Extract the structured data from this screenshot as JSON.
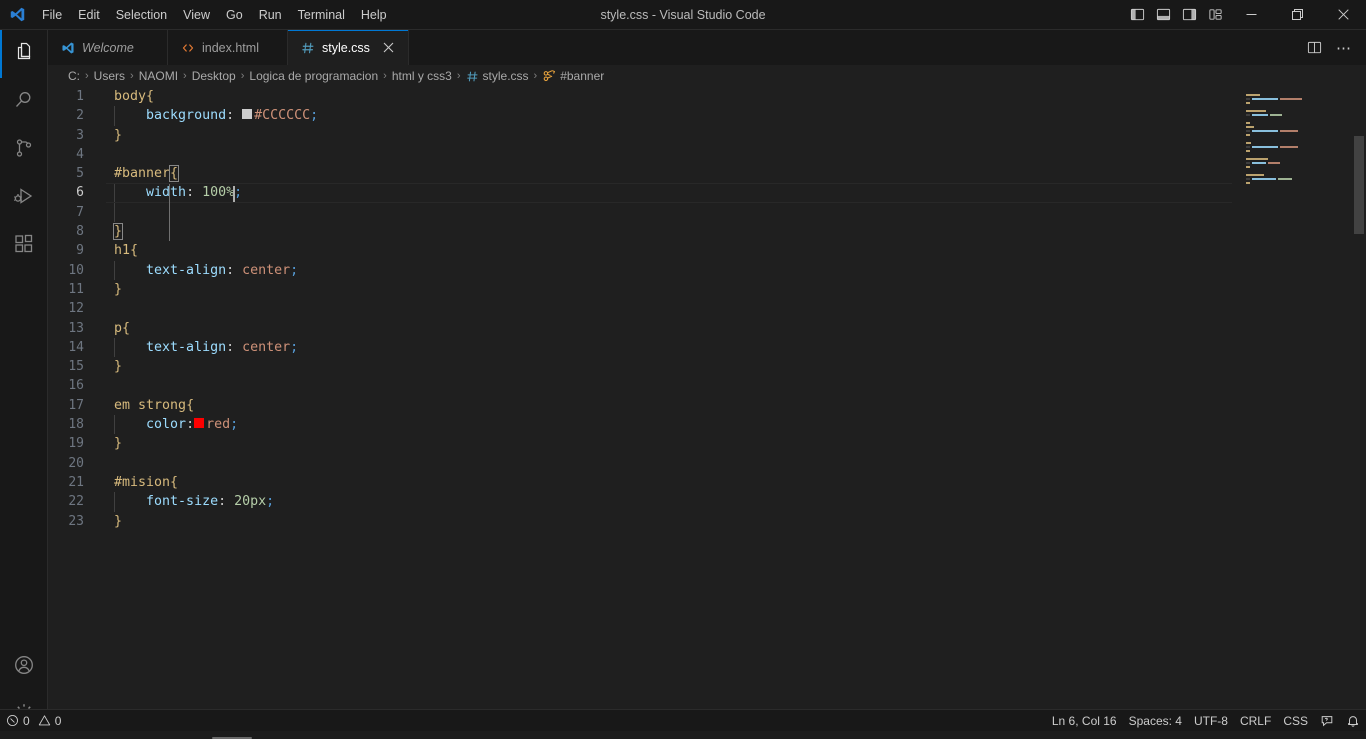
{
  "window": {
    "title": "style.css - Visual Studio Code",
    "logo_icon": "vscode-logo-icon",
    "menus": [
      "File",
      "Edit",
      "Selection",
      "View",
      "Go",
      "Run",
      "Terminal",
      "Help"
    ],
    "layout_buttons": [
      {
        "name": "toggle-primary-sidebar-icon",
        "label": "Toggle Primary Side Bar"
      },
      {
        "name": "toggle-panel-icon",
        "label": "Toggle Panel"
      },
      {
        "name": "toggle-secondary-sidebar-icon",
        "label": "Toggle Secondary Side Bar"
      },
      {
        "name": "customize-layout-icon",
        "label": "Customize Layout"
      }
    ],
    "controls": [
      {
        "name": "minimize-button",
        "glyph": "─"
      },
      {
        "name": "maximize-button",
        "glyph": "❑"
      },
      {
        "name": "close-button",
        "glyph": "✕"
      }
    ]
  },
  "activitybar": {
    "items": [
      {
        "name": "explorer",
        "icon": "files-icon",
        "active": true
      },
      {
        "name": "search",
        "icon": "search-icon",
        "active": false
      },
      {
        "name": "source-control",
        "icon": "source-control-icon",
        "active": false
      },
      {
        "name": "run-and-debug",
        "icon": "run-debug-icon",
        "active": false
      },
      {
        "name": "extensions",
        "icon": "extensions-icon",
        "active": false
      }
    ],
    "bottom": [
      {
        "name": "accounts",
        "icon": "account-icon"
      },
      {
        "name": "manage",
        "icon": "gear-icon"
      }
    ]
  },
  "tabs": [
    {
      "label": "Welcome",
      "icon": "vscode-logo-icon",
      "active": false,
      "italic": true,
      "dirty": false,
      "closable": false
    },
    {
      "label": "index.html",
      "icon": "html-icon",
      "active": false,
      "italic": false,
      "dirty": false,
      "closable": false
    },
    {
      "label": "style.css",
      "icon": "css-icon",
      "active": true,
      "italic": false,
      "dirty": false,
      "closable": true
    }
  ],
  "tab_actions": [
    {
      "name": "split-editor-right-button",
      "icon": "split-editor-icon"
    },
    {
      "name": "more-actions-button",
      "icon": "ellipsis-icon",
      "glyph": "⋯"
    }
  ],
  "breadcrumbs": {
    "separator": "›",
    "items": [
      {
        "label": "C:",
        "icon": null
      },
      {
        "label": "Users",
        "icon": null
      },
      {
        "label": "NAOMI",
        "icon": null
      },
      {
        "label": "Desktop",
        "icon": null
      },
      {
        "label": "Logica de programacion",
        "icon": null
      },
      {
        "label": "html y css3",
        "icon": null
      },
      {
        "label": "style.css",
        "icon": "css-icon"
      },
      {
        "label": "#banner",
        "icon": "css-symbol-icon"
      }
    ]
  },
  "editor": {
    "language": "CSS",
    "code_lines": [
      {
        "n": 1,
        "tokens": [
          {
            "t": "sel",
            "v": "body"
          },
          {
            "t": "brace",
            "v": "{"
          }
        ]
      },
      {
        "n": 2,
        "indent": 1,
        "tokens": [
          {
            "t": "prop",
            "v": "background"
          },
          {
            "t": "punc",
            "v": ": "
          },
          {
            "t": "swatch",
            "v": "#CCCCCC"
          },
          {
            "t": "val",
            "v": "#CCCCCC"
          },
          {
            "t": "semi",
            "v": ";"
          }
        ]
      },
      {
        "n": 3,
        "tokens": [
          {
            "t": "brace",
            "v": "}"
          }
        ]
      },
      {
        "n": 4,
        "tokens": []
      },
      {
        "n": 5,
        "tokens": [
          {
            "t": "sel",
            "v": "#banner"
          },
          {
            "t": "brace-match",
            "v": "{"
          }
        ]
      },
      {
        "n": 6,
        "indent": 1,
        "current": true,
        "tokens": [
          {
            "t": "prop",
            "v": "width"
          },
          {
            "t": "punc",
            "v": ": "
          },
          {
            "t": "num",
            "v": "100%"
          },
          {
            "t": "cursor",
            "v": ""
          },
          {
            "t": "semi",
            "v": ";"
          }
        ]
      },
      {
        "n": 7,
        "indent": 1,
        "tokens": []
      },
      {
        "n": 8,
        "tokens": [
          {
            "t": "brace-match",
            "v": "}"
          }
        ]
      },
      {
        "n": 9,
        "tokens": [
          {
            "t": "sel",
            "v": "h1"
          },
          {
            "t": "brace",
            "v": "{"
          }
        ]
      },
      {
        "n": 10,
        "indent": 1,
        "tokens": [
          {
            "t": "prop",
            "v": "text-align"
          },
          {
            "t": "punc",
            "v": ": "
          },
          {
            "t": "val",
            "v": "center"
          },
          {
            "t": "semi",
            "v": ";"
          }
        ]
      },
      {
        "n": 11,
        "tokens": [
          {
            "t": "brace",
            "v": "}"
          }
        ]
      },
      {
        "n": 12,
        "tokens": []
      },
      {
        "n": 13,
        "tokens": [
          {
            "t": "sel",
            "v": "p"
          },
          {
            "t": "brace",
            "v": "{"
          }
        ]
      },
      {
        "n": 14,
        "indent": 1,
        "tokens": [
          {
            "t": "prop",
            "v": "text-align"
          },
          {
            "t": "punc",
            "v": ": "
          },
          {
            "t": "val",
            "v": "center"
          },
          {
            "t": "semi",
            "v": ";"
          }
        ]
      },
      {
        "n": 15,
        "tokens": [
          {
            "t": "brace",
            "v": "}"
          }
        ]
      },
      {
        "n": 16,
        "tokens": []
      },
      {
        "n": 17,
        "tokens": [
          {
            "t": "sel",
            "v": "em strong"
          },
          {
            "t": "brace",
            "v": "{"
          }
        ]
      },
      {
        "n": 18,
        "indent": 1,
        "tokens": [
          {
            "t": "prop",
            "v": "color"
          },
          {
            "t": "punc",
            "v": ":"
          },
          {
            "t": "swatch",
            "v": "#FF0000"
          },
          {
            "t": "val",
            "v": "red"
          },
          {
            "t": "semi",
            "v": ";"
          }
        ]
      },
      {
        "n": 19,
        "tokens": [
          {
            "t": "brace",
            "v": "}"
          }
        ]
      },
      {
        "n": 20,
        "tokens": []
      },
      {
        "n": 21,
        "tokens": [
          {
            "t": "sel",
            "v": "#mision"
          },
          {
            "t": "brace",
            "v": "{"
          }
        ]
      },
      {
        "n": 22,
        "indent": 1,
        "tokens": [
          {
            "t": "prop",
            "v": "font-size"
          },
          {
            "t": "punc",
            "v": ": "
          },
          {
            "t": "num",
            "v": "20px"
          },
          {
            "t": "semi",
            "v": ";"
          }
        ]
      },
      {
        "n": 23,
        "tokens": [
          {
            "t": "brace",
            "v": "}"
          }
        ]
      }
    ]
  },
  "minimap": {
    "lines": [
      [
        {
          "w": 14,
          "c": "#d7ba7d"
        }
      ],
      [
        {
          "w": 4,
          "c": "#444"
        },
        {
          "w": 26,
          "c": "#9cdcfe"
        },
        {
          "w": 22,
          "c": "#ce9178"
        }
      ],
      [
        {
          "w": 4,
          "c": "#d7ba7d"
        }
      ],
      [],
      [
        {
          "w": 20,
          "c": "#d7ba7d"
        }
      ],
      [
        {
          "w": 4,
          "c": "#444"
        },
        {
          "w": 16,
          "c": "#9cdcfe"
        },
        {
          "w": 12,
          "c": "#b5cea8"
        }
      ],
      [],
      [
        {
          "w": 4,
          "c": "#d7ba7d"
        }
      ],
      [
        {
          "w": 8,
          "c": "#d7ba7d"
        }
      ],
      [
        {
          "w": 4,
          "c": "#444"
        },
        {
          "w": 26,
          "c": "#9cdcfe"
        },
        {
          "w": 18,
          "c": "#ce9178"
        }
      ],
      [
        {
          "w": 4,
          "c": "#d7ba7d"
        }
      ],
      [],
      [
        {
          "w": 5,
          "c": "#d7ba7d"
        }
      ],
      [
        {
          "w": 4,
          "c": "#444"
        },
        {
          "w": 26,
          "c": "#9cdcfe"
        },
        {
          "w": 18,
          "c": "#ce9178"
        }
      ],
      [
        {
          "w": 4,
          "c": "#d7ba7d"
        }
      ],
      [],
      [
        {
          "w": 22,
          "c": "#d7ba7d"
        }
      ],
      [
        {
          "w": 4,
          "c": "#444"
        },
        {
          "w": 14,
          "c": "#9cdcfe"
        },
        {
          "w": 12,
          "c": "#ce9178"
        }
      ],
      [
        {
          "w": 4,
          "c": "#d7ba7d"
        }
      ],
      [],
      [
        {
          "w": 18,
          "c": "#d7ba7d"
        }
      ],
      [
        {
          "w": 4,
          "c": "#444"
        },
        {
          "w": 24,
          "c": "#9cdcfe"
        },
        {
          "w": 14,
          "c": "#b5cea8"
        }
      ],
      [
        {
          "w": 4,
          "c": "#d7ba7d"
        }
      ]
    ]
  },
  "statusbar": {
    "left": [
      {
        "name": "problems-errors",
        "icon": "error-icon",
        "value": "0"
      },
      {
        "name": "problems-warnings",
        "icon": "warning-icon",
        "value": "0"
      }
    ],
    "right": [
      {
        "name": "editor-position",
        "label": "Ln 6, Col 16"
      },
      {
        "name": "editor-indentation",
        "label": "Spaces: 4"
      },
      {
        "name": "editor-encoding",
        "label": "UTF-8"
      },
      {
        "name": "editor-eol",
        "label": "CRLF"
      },
      {
        "name": "editor-language",
        "label": "CSS"
      },
      {
        "name": "feedback-icon",
        "label": ""
      },
      {
        "name": "notifications-bell-icon",
        "label": ""
      }
    ]
  },
  "colors": {
    "accent": "#0078d4",
    "titlebar_bg": "#181818",
    "editor_bg": "#1f1f1f",
    "selector": "#d7ba7d",
    "property": "#9cdcfe",
    "value": "#ce9178",
    "number": "#b5cea8"
  }
}
